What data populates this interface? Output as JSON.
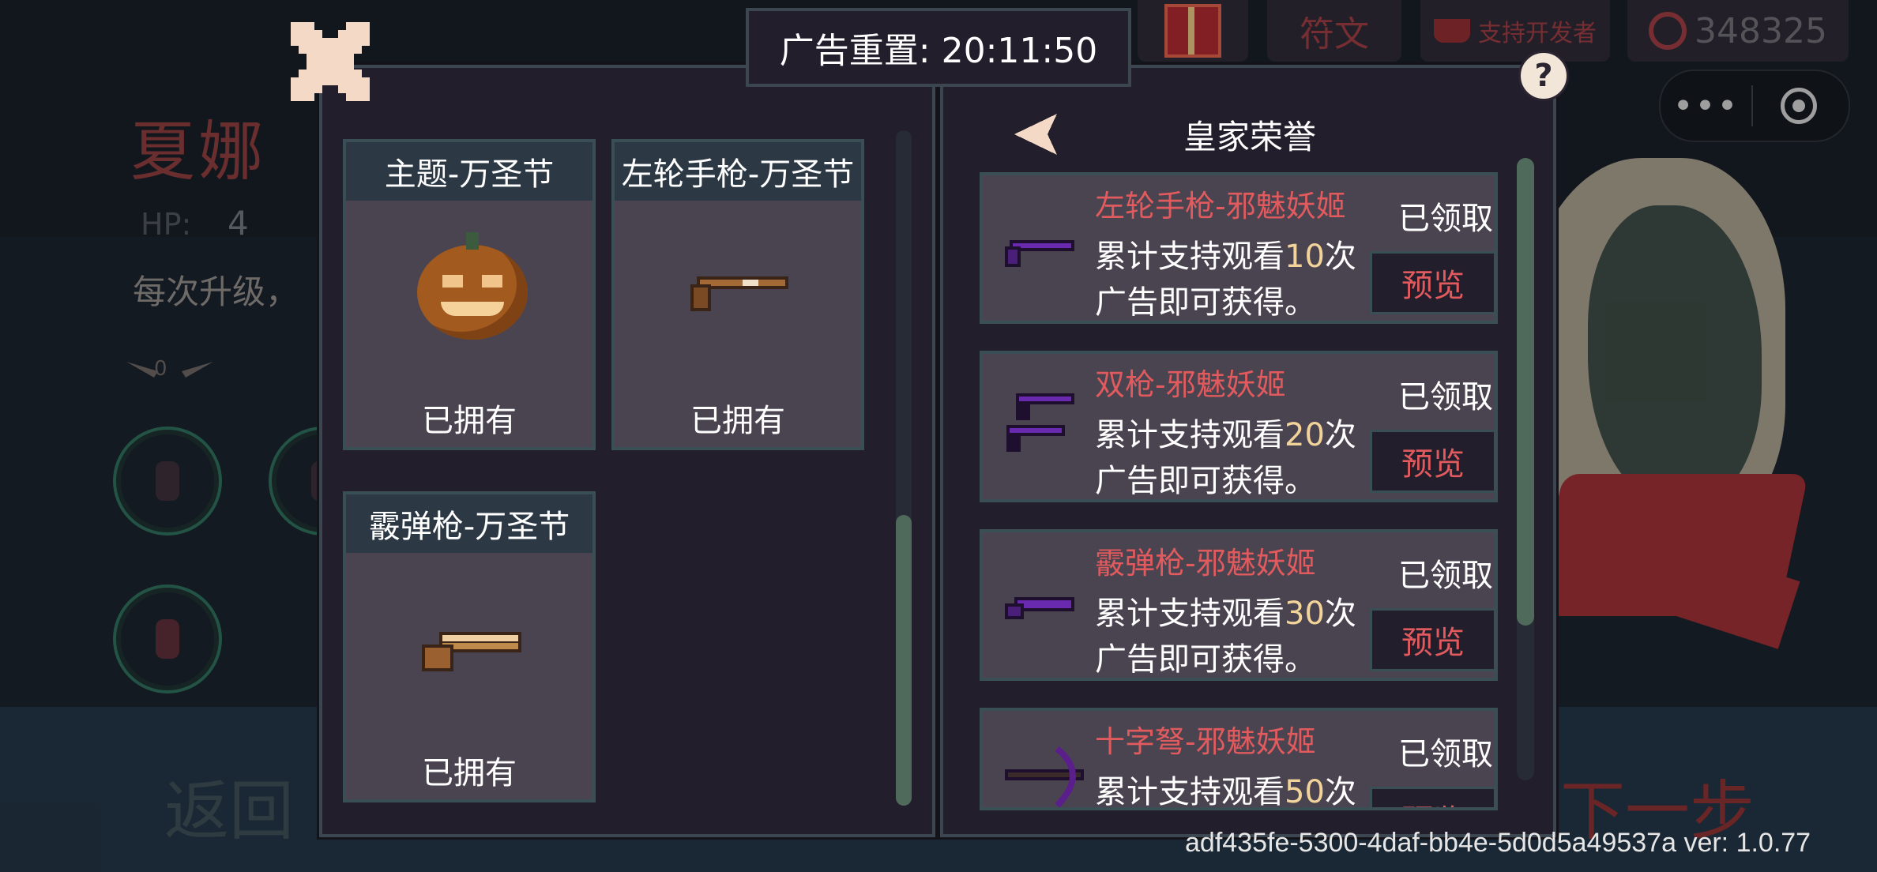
{
  "background": {
    "character_name": "夏娜",
    "hp_label": "HP:",
    "hp_value": "4",
    "description": "每次升级，",
    "wing_badge": "0",
    "back_button": "返回",
    "next_button": "下一步",
    "version_text": "adf435fe-5300-4daf-bb4e-5d0d5a49537a ver: 1.0.77"
  },
  "top_menu": {
    "rune_tab": "符文",
    "support_tab": "支持开发者",
    "currency_value": "348325",
    "more_icon": "more-dots-icon",
    "capsule_dots": "•••"
  },
  "dialog": {
    "timer_label": "广告重置: 20:11:50",
    "help_label": "?",
    "owned_items": [
      {
        "title": "主题-万圣节",
        "status": "已拥有",
        "icon": "pumpkin-icon"
      },
      {
        "title": "左轮手枪-万圣节",
        "status": "已拥有",
        "icon": "revolver-icon"
      },
      {
        "title": "霰弹枪-万圣节",
        "status": "已拥有",
        "icon": "shotgun-icon"
      }
    ],
    "right_title": "皇家荣誉",
    "rewards": [
      {
        "name": "左轮手枪-邪魅妖姬",
        "desc_prefix": "累计支持观看",
        "count": "10",
        "desc_suffix": "次",
        "desc_line2": "广告即可获得。",
        "status": "已领取",
        "button": "预览",
        "icon": "revolver-icon"
      },
      {
        "name": "双枪-邪魅妖姬",
        "desc_prefix": "累计支持观看",
        "count": "20",
        "desc_suffix": "次",
        "desc_line2": "广告即可获得。",
        "status": "已领取",
        "button": "预览",
        "icon": "dual-guns-icon"
      },
      {
        "name": "霰弹枪-邪魅妖姬",
        "desc_prefix": "累计支持观看",
        "count": "30",
        "desc_suffix": "次",
        "desc_line2": "广告即可获得。",
        "status": "已领取",
        "button": "预览",
        "icon": "shotgun-icon"
      },
      {
        "name": "十字弩-邪魅妖姬",
        "desc_prefix": "累计支持观看",
        "count": "50",
        "desc_suffix": "次",
        "desc_line2": "",
        "status": "已领取",
        "button": "预览",
        "icon": "crossbow-icon"
      }
    ]
  },
  "colors": {
    "accent_red": "#e05a5e",
    "highlight_number": "#f2d49a",
    "panel_bg": "#221e2b",
    "card_bg": "#4a4450"
  }
}
